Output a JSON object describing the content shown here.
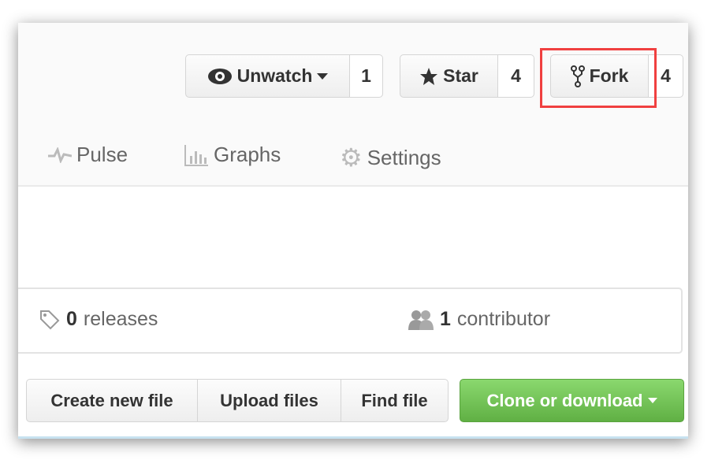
{
  "header": {
    "watch": {
      "label": "Unwatch",
      "count": "1"
    },
    "star": {
      "label": "Star",
      "count": "4"
    },
    "fork": {
      "label": "Fork",
      "count": "4"
    }
  },
  "nav": [
    {
      "label": "Pulse",
      "icon": "pulse-icon"
    },
    {
      "label": "Graphs",
      "icon": "graph-icon"
    },
    {
      "label": "Settings",
      "icon": "gear-icon"
    }
  ],
  "summary": {
    "releases_count": "0",
    "releases_label": "releases",
    "contributors_count": "1",
    "contributors_label": "contributor"
  },
  "file_actions": {
    "create": "Create new file",
    "upload": "Upload files",
    "find": "Find file",
    "clone": "Clone or download"
  },
  "colors": {
    "highlight": "#f04040",
    "clone_button": "#60b044"
  }
}
